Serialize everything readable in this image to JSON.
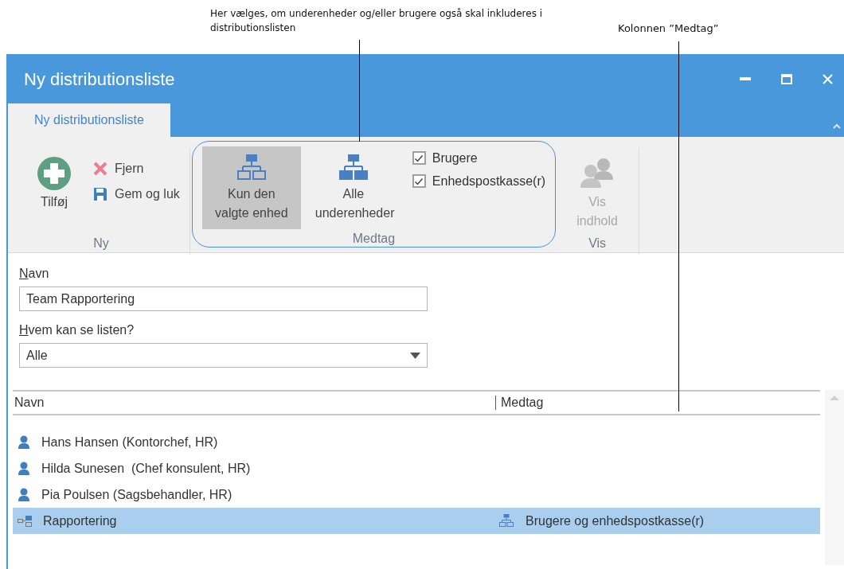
{
  "annotations": [
    {
      "text": "Her vælges, om underenheder og/eller brugere også skal inkluderes i distributionslisten"
    },
    {
      "text": "Kolonnen ”Medtag”"
    }
  ],
  "window": {
    "title": "Ny distributionsliste"
  },
  "tabs": [
    {
      "label": "Ny distributionsliste",
      "selected": true
    }
  ],
  "ribbon": {
    "groups": [
      {
        "label": "Ny",
        "highlighted": false,
        "items": [
          {
            "kind": "large",
            "label": "Tilføj",
            "disabled": false
          },
          {
            "kind": "small",
            "label": "Fjern",
            "disabled": false
          },
          {
            "kind": "small",
            "label": "Gem og luk",
            "disabled": false
          }
        ]
      },
      {
        "label": "Medtag",
        "highlighted": true,
        "items": [
          {
            "kind": "toggle",
            "label": "Kun den valgte enhed",
            "selected": true
          },
          {
            "kind": "toggle",
            "label": "Alle underenheder",
            "selected": false
          },
          {
            "kind": "checkbox",
            "label": "Brugere",
            "checked": true
          },
          {
            "kind": "checkbox",
            "label": "Enhedspostkasse(r)",
            "checked": true
          }
        ]
      },
      {
        "label": "Vis",
        "highlighted": false,
        "items": [
          {
            "kind": "large",
            "label": "Vis indhold",
            "disabled": true
          }
        ]
      }
    ]
  },
  "form": {
    "name_label": "Navn",
    "name_value": "Team Rapportering",
    "visibility_label": "Hvem kan se listen?",
    "visibility_value": "Alle"
  },
  "list": {
    "columns": [
      "Navn",
      "Medtag"
    ],
    "rows": [
      {
        "kind": "user",
        "name": "Hans Hansen (Kontorchef, HR)",
        "selected": false
      },
      {
        "kind": "user",
        "name": "Hilda Sunesen  (Chef konsulent, HR)",
        "selected": false
      },
      {
        "kind": "user",
        "name": "Pia Poulsen (Sagsbehandler, HR)",
        "selected": false
      },
      {
        "kind": "unit",
        "name": "Rapportering",
        "include": "Brugere og enhedspostkasse(r)",
        "selected": true
      }
    ]
  }
}
